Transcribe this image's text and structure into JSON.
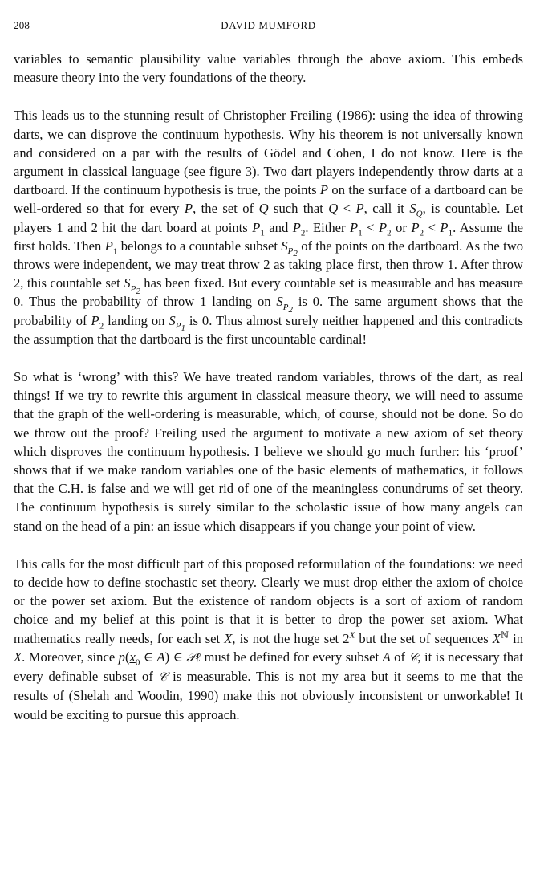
{
  "header": {
    "page_number": "208",
    "running_head": "DAVID MUMFORD"
  },
  "paragraphs": [
    {
      "html": "variables to semantic plausibility value variables through the above axiom. This embeds measure theory into the very foundations of the theory."
    },
    {
      "html": "This leads us to the stunning result of Christopher Freiling (1986): using the idea of throwing darts, we can disprove the continuum hypothesis. Why his theorem is not universally known and considered on a par with the results of Gödel and Cohen, I do not know. Here is the argument in classical language (see figure 3). Two dart players independently throw darts at a dartboard. If the continuum hypothesis is true, the points <i class=\"m\">P</i> on the surface of a dartboard can be well-ordered so that for every <i class=\"m\">P</i>, the set of <i class=\"m\">Q</i> such that <i class=\"m\">Q</i> &lt; <i class=\"m\">P</i>, call it <i class=\"m\">S<sub>Q</sub></i>, is countable. Let players 1 and 2 hit the dart board at points <i class=\"m\">P</i><sub>1</sub> and <i class=\"m\">P</i><sub>2</sub>. Either <i class=\"m\">P</i><sub>1</sub> &lt; <i class=\"m\">P</i><sub>2</sub> or <i class=\"m\">P</i><sub>2</sub> &lt; <i class=\"m\">P</i><sub>1</sub>. Assume the first holds. Then <i class=\"m\">P</i><sub>1</sub> belongs to a countable subset <i class=\"m\">S<sub>P<sub>2</sub></sub></i> of the points on the dartboard. As the two throws were independent, we may treat throw 2 as taking place first, then throw 1. After throw 2, this countable set <i class=\"m\">S<sub>P<sub>2</sub></sub></i> has been fixed. But every countable set is measurable and has measure 0. Thus the probability of throw 1 landing on <i class=\"m\">S<sub>P<sub>2</sub></sub></i> is 0. The same argument shows that the probability of <i class=\"m\">P</i><sub>2</sub> landing on <i class=\"m\">S<sub>P<sub>1</sub></sub></i> is 0. Thus almost surely neither happened and this contradicts the assumption that the dartboard is the first uncountable cardinal!"
    },
    {
      "html": "So what is ‘wrong’ with this? We have treated random variables, throws of the dart, as real things! If we try to rewrite this argument in classical measure theory, we will need to assume that the graph of the well-ordering is measurable, which, of course, should not be done. So do we throw out the proof? Freiling used the argument to motivate a new axiom of set theory which disproves the continuum hypothesis. I believe we should go much further: his ‘proof’ shows that if we make random variables one of the basic elements of mathematics, it follows that the C.H. is false and we will get rid of one of the meaningless conundrums of set theory. The continuum hypothesis is surely similar to the scholastic issue of how many angels can stand on the head of a pin: an issue which disappears if you change your point of view."
    },
    {
      "html": "This calls for the most difficult part of this proposed reformulation of the foundations: we need to decide how to define stochastic set theory. Clearly we must drop either the axiom of choice or the power set axiom. But the existence of random objects is a sort of axiom of random choice and my belief at this point is that it is better to drop the power set axiom. What mathematics really needs, for each set <i class=\"m\">X</i>, is not the huge set 2<sup><i>X</i></sup> but the set of sequences <i class=\"m\">X</i><sup>ℕ</sup> in <i class=\"m\">X</i>. Moreover, since <i class=\"m\">p</i>(<i class=\"m ul\">x</i><sub>0</sub> ∈ <i class=\"m\">A</i>) ∈ <span class=\"cal\">𝒫ℓ</span> must be defined for every subset <i class=\"m\">A</i> of <span class=\"cal\">𝒞</span>, it is necessary that every definable subset of <span class=\"cal\">𝒞</span> is measurable. This is not my area but it seems to me that the results of (Shelah and Woodin, 1990) make this not obviously inconsistent or unworkable! It would be exciting to pursue this approach."
    }
  ]
}
